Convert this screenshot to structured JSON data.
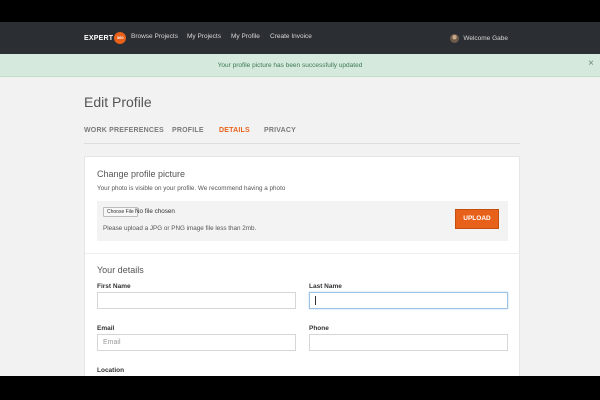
{
  "nav": {
    "logo_text": "EXPERT",
    "logo_badge": "360",
    "links": [
      "Browse Projects",
      "My Projects",
      "My Profile",
      "Create Invoice"
    ],
    "welcome": "Welcome Gabe"
  },
  "alert": {
    "message": "Your profile picture has been successfully updated",
    "close": "×"
  },
  "page": {
    "title": "Edit Profile",
    "tabs": [
      "WORK PREFERENCES",
      "PROFILE",
      "DETAILS",
      "PRIVACY"
    ],
    "active_tab": "DETAILS"
  },
  "picture": {
    "heading": "Change profile picture",
    "help": "Your photo is visible on your profile. We recommend having a photo",
    "choose_file": "Choose File",
    "file_status": "No file chosen",
    "hint": "Please upload a JPG or PNG image file less than 2mb.",
    "upload": "UPLOAD"
  },
  "details": {
    "heading": "Your details",
    "first_name_label": "First Name",
    "first_name_value": "",
    "last_name_label": "Last Name",
    "last_name_value": "",
    "email_label": "Email",
    "email_placeholder": "Email",
    "phone_label": "Phone",
    "phone_value": "",
    "location_label": "Location"
  },
  "colors": {
    "accent": "#e8611a",
    "navbar": "#2b2e33",
    "alert_bg": "#d5e9dd",
    "alert_text": "#3c7a52"
  }
}
